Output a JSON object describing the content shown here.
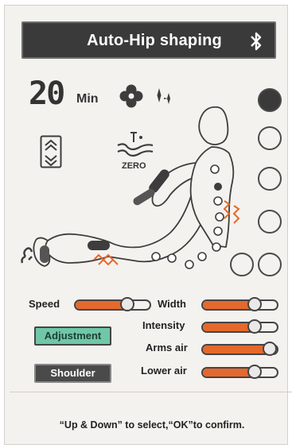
{
  "header": {
    "title": "Auto-Hip shaping",
    "icon": "bluetooth-icon"
  },
  "timer": {
    "value": "20",
    "unit": "Min"
  },
  "status_icons": [
    "fan-icon",
    "sparkle-icon",
    "seat-adjust-icon",
    "zero-gravity-icon"
  ],
  "zero_label": "ZERO",
  "sliders": {
    "speed": {
      "label": "Speed",
      "level": 0.75
    },
    "width": {
      "label": "Width",
      "level": 0.75
    },
    "intensity": {
      "label": "Intensity",
      "level": 0.75
    },
    "arms_air": {
      "label": "Arms air",
      "level": 1.0
    },
    "lower_air": {
      "label": "Lower air",
      "level": 0.75
    }
  },
  "buttons": {
    "adjustment": "Adjustment",
    "shoulder": "Shoulder"
  },
  "instruction": "“Up & Down” to select,“OK”to confirm.",
  "colors": {
    "accent": "#e5682c",
    "header_bg": "#3a3a3a",
    "adjust_bg": "#6fc7a8",
    "panel_bg": "#f4f2ee"
  }
}
